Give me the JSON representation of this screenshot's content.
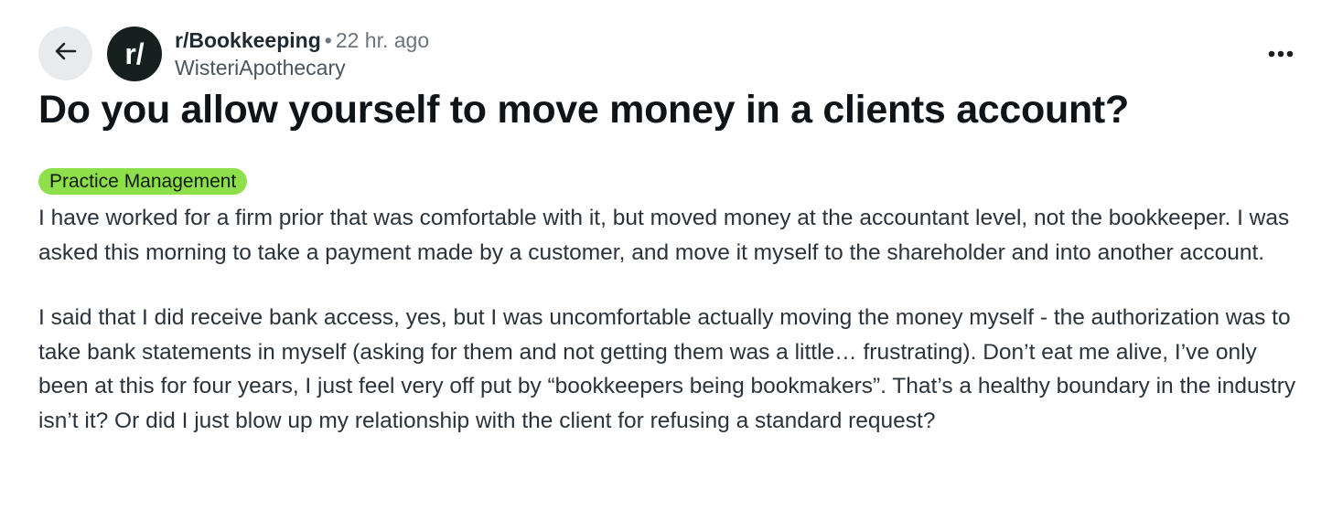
{
  "header": {
    "subreddit": "r/Bookkeeping",
    "separator": "•",
    "time_ago": "22 hr. ago",
    "author": "WisteriApothecary",
    "avatar_glyph": "r/",
    "avatar_bg": "#16211f"
  },
  "icons": {
    "back": "arrow-left-icon",
    "more": "more-horizontal-icon"
  },
  "post": {
    "title": "Do you allow yourself to move money in a clients account?",
    "flair": "Practice Management",
    "flair_color": "#8ee04a",
    "body": [
      "I have worked for a firm prior that was comfortable with it, but moved money at the accountant level, not the bookkeeper. I was asked this morning to take a payment made by a customer, and move it myself to the shareholder and into another account.",
      "I said that I did receive bank access, yes, but I was uncomfortable actually moving the money myself - the authorization was to take bank statements in myself (asking for them and not getting them was a little… frustrating). Don’t eat me alive, I’ve only been at this for four years, I just feel very off put by “bookkeepers being bookmakers”. That’s a healthy boundary in the industry isn’t it? Or did I just blow up my relationship with the client for refusing a standard request?"
    ]
  }
}
